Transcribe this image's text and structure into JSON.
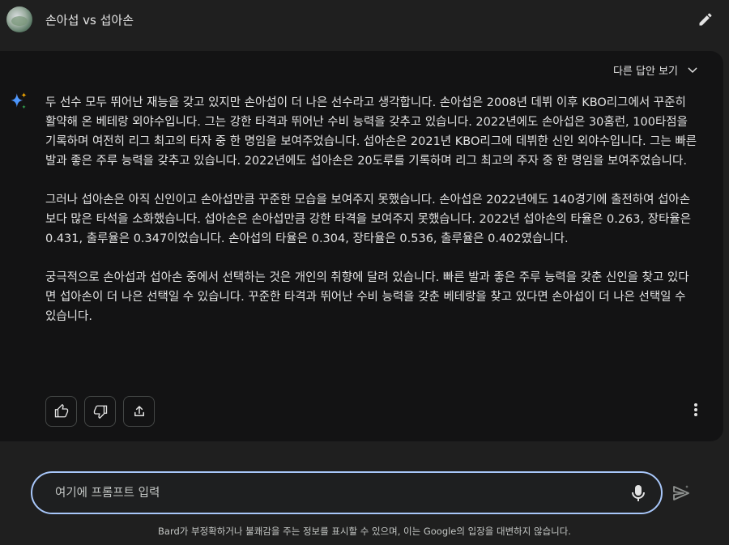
{
  "header": {
    "title": "손아섭 vs 섭아손"
  },
  "card": {
    "other_answers_label": "다른 답안 보기",
    "paragraphs": [
      "두 선수 모두 뛰어난 재능을 갖고 있지만 손아섭이 더 나은 선수라고 생각합니다. 손아섭은 2008년 데뷔 이후 KBO리그에서 꾸준히 활약해 온 베테랑 외야수입니다. 그는 강한 타격과 뛰어난 수비 능력을 갖추고 있습니다. 2022년에도 손아섭은 30홈런, 100타점을 기록하며 여전히 리그 최고의 타자 중 한 명임을 보여주었습니다. 섭아손은 2021년 KBO리그에 데뷔한 신인 외야수입니다. 그는 빠른 발과 좋은 주루 능력을 갖추고 있습니다. 2022년에도 섭아손은 20도루를 기록하며 리그 최고의 주자 중 한 명임을 보여주었습니다.",
      "그러나 섭아손은 아직 신인이고 손아섭만큼 꾸준한 모습을 보여주지 못했습니다. 손아섭은 2022년에도 140경기에 출전하여 섭아손보다 많은 타석을 소화했습니다. 섭아손은 손아섭만큼 강한 타격을 보여주지 못했습니다. 2022년 섭아손의 타율은 0.263, 장타율은 0.431, 출루율은 0.347이었습니다. 손아섭의 타율은 0.304, 장타율은 0.536, 출루율은 0.402였습니다.",
      "궁극적으로 손아섭과 섭아손 중에서 선택하는 것은 개인의 취향에 달려 있습니다. 빠른 발과 좋은 주루 능력을 갖춘 신인을 찾고 있다면 섭아손이 더 나은 선택일 수 있습니다. 꾸준한 타격과 뛰어난 수비 능력을 갖춘 베테랑을 찾고 있다면 손아섭이 더 나은 선택일 수 있습니다."
    ]
  },
  "icons": {
    "avatar": "avatar",
    "edit": "pencil-icon",
    "expand": "chevron-down-icon",
    "bard": "sparkle-icon",
    "like": "thumbs-up-icon",
    "dislike": "thumbs-down-icon",
    "share": "share-icon",
    "more": "more-vert-icon",
    "mic": "mic-icon",
    "send": "send-icon"
  },
  "input": {
    "placeholder": "여기에 프롬프트 입력",
    "value": ""
  },
  "footer": {
    "disclaimer": "Bard가 부정확하거나 불쾌감을 주는 정보를 표시할 수 있으며, 이는 Google의 입장을 대변하지 않습니다."
  },
  "colors": {
    "background": "#1f1f1f",
    "card": "#131314",
    "accent_border": "#a8c7fa",
    "text": "#e3e3e3",
    "sparkle_blue": "#4285f4",
    "sparkle_yellow": "#f9ab00"
  }
}
